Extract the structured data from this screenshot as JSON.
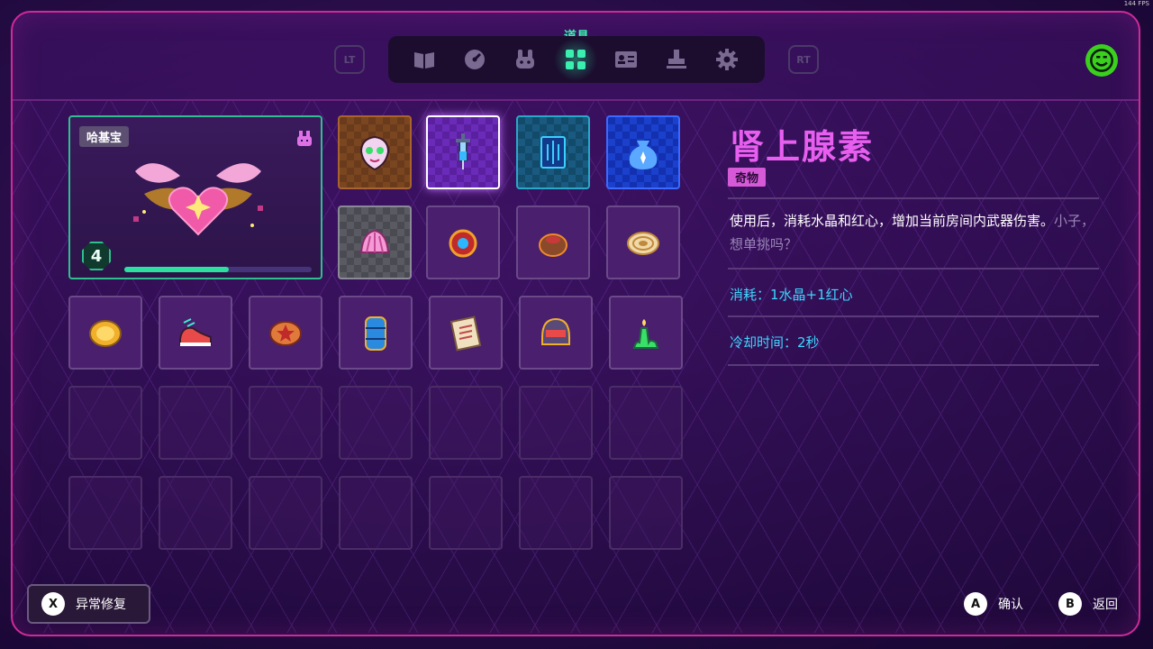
{
  "fps_label": "144 FPS",
  "nav": {
    "left_bumper": "LT",
    "right_bumper": "RT",
    "active_tab_label": "道具",
    "tabs": [
      {
        "icon": "book-icon"
      },
      {
        "icon": "gauge-icon"
      },
      {
        "icon": "pet-icon"
      },
      {
        "icon": "grid-icon",
        "active": true
      },
      {
        "icon": "id-card-icon"
      },
      {
        "icon": "stamp-icon"
      },
      {
        "icon": "gear-icon"
      }
    ],
    "accent_color": "#3af0b0"
  },
  "character": {
    "name": "哈基宝",
    "level": "4",
    "progress": 0.56,
    "icon": "winged-heart-icon"
  },
  "items_row1": [
    {
      "icon": "alien-mask-icon"
    },
    {
      "icon": "syringe-icon",
      "selected": true
    },
    {
      "icon": "blue-tome-icon"
    },
    {
      "icon": "money-bag-icon"
    }
  ],
  "items_row2": [
    {
      "icon": "pink-shell-icon"
    },
    {
      "icon": "gem-amulet-icon"
    },
    {
      "icon": "clay-pot-icon"
    },
    {
      "icon": "spiral-disc-icon"
    }
  ],
  "items_row3": [
    {
      "icon": "gold-coin-icon"
    },
    {
      "icon": "sneaker-icon"
    },
    {
      "icon": "star-badge-icon"
    },
    {
      "icon": "blue-barrel-icon"
    },
    {
      "icon": "paper-scroll-icon"
    },
    {
      "icon": "helmet-icon"
    },
    {
      "icon": "green-candle-icon"
    }
  ],
  "detail": {
    "title": "肾上腺素",
    "tag": "奇物",
    "description": "使用后，消耗水晶和红心，增加当前房间内武器伤害。",
    "flavor": "小子，想单挑吗？",
    "cost": "消耗：1水晶+1红心",
    "cooldown": "冷却时间：2秒"
  },
  "footer": {
    "repair_key": "X",
    "repair_label": "异常修复",
    "confirm_key": "A",
    "confirm_label": "确认",
    "back_key": "B",
    "back_label": "返回"
  }
}
